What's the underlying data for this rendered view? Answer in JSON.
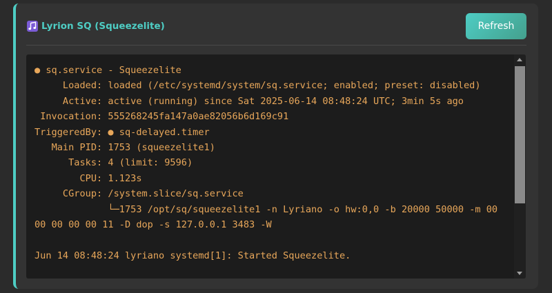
{
  "header": {
    "title": "Lyrion SQ (Squeezelite)",
    "title_icon": "music-note-icon",
    "refresh_label": "Refresh"
  },
  "log": {
    "lines": [
      "● sq.service - Squeezelite",
      "     Loaded: loaded (/etc/systemd/system/sq.service; enabled; preset: disabled)",
      "     Active: active (running) since Sat 2025-06-14 08:48:24 UTC; 3min 5s ago",
      " Invocation: 555268245fa147a0ae82056b6d169c91",
      "TriggeredBy: ● sq-delayed.timer",
      "   Main PID: 1753 (squeezelite1)",
      "      Tasks: 4 (limit: 9596)",
      "        CPU: 1.123s",
      "     CGroup: /system.slice/sq.service",
      "             └─1753 /opt/sq/squeezelite1 -n Lyriano -o hw:0,0 -b 20000 50000 -m 00 00 00 00 00 11 -D dop -s 127.0.0.1 3483 -W",
      "",
      "Jun 14 08:48:24 lyriano systemd[1]: Started Squeezelite."
    ]
  },
  "colors": {
    "accent": "#4ecdc4",
    "log_text": "#e8a75a",
    "log_background": "#1c1c1c",
    "card_background": "#333333"
  }
}
